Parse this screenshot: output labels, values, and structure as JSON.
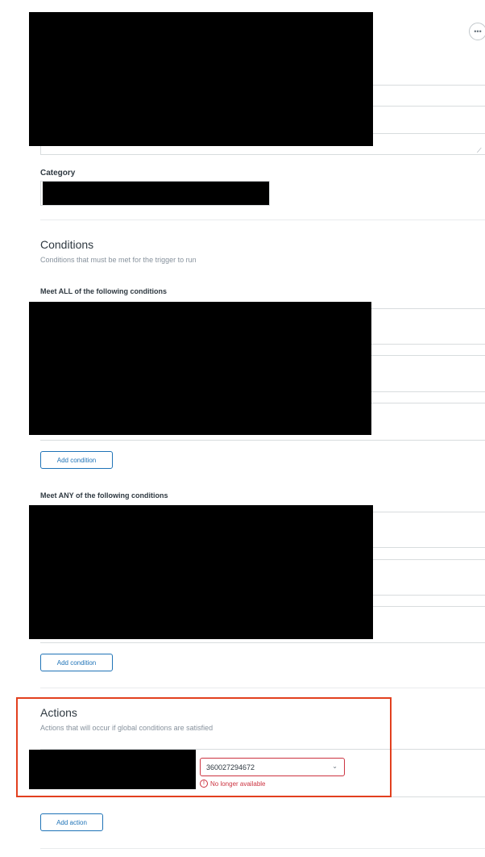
{
  "category": {
    "label": "Category"
  },
  "conditions": {
    "title": "Conditions",
    "subtitle": "Conditions that must be met for the trigger to run",
    "all": {
      "label": "Meet ALL of the following conditions",
      "add_label": "Add condition"
    },
    "any": {
      "label": "Meet ANY of the following conditions",
      "add_label": "Add condition"
    }
  },
  "actions": {
    "title": "Actions",
    "subtitle": "Actions that will occur if global conditions are satisfied",
    "select_value": "360027294672",
    "error_text": "No longer available",
    "add_label": "Add action"
  },
  "icons": {
    "more": "more-horizontal-icon",
    "chevron": "chevron-down-icon",
    "error": "alert-error-icon"
  },
  "colors": {
    "accent": "#1f73b7",
    "error": "#cc3340",
    "highlight": "#e2401f"
  }
}
